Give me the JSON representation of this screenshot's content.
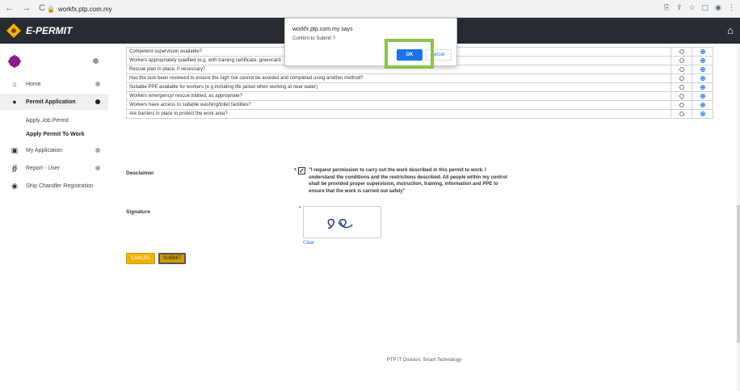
{
  "browser": {
    "url": "workfx.ptp.com.my",
    "nav_back": "←",
    "nav_forward": "→",
    "nav_reload": "C",
    "tools": [
      "⎘",
      "⇪",
      "☆",
      "▢",
      "◉",
      "⋮"
    ]
  },
  "topbar": {
    "brand": "E-PERMIT",
    "home_icon": "home-icon"
  },
  "sidebar": {
    "items": [
      {
        "label": "Home"
      },
      {
        "label": "Permit Application"
      },
      {
        "label": "Apply Job Permit"
      },
      {
        "label": "Apply Permit To Work"
      },
      {
        "label": "My Application"
      },
      {
        "label": "Report - User"
      },
      {
        "label": "Ship Chandler Registration"
      }
    ]
  },
  "questions": [
    {
      "text": "Competent supervision available?",
      "selected": "no"
    },
    {
      "text": "Workers appropriately qualified (e.g. with training certificate, greencard",
      "selected": "no"
    },
    {
      "text": "Rescue plan in place, if necessary?",
      "selected": "no"
    },
    {
      "text": "Has the task been reviewed to ensure the high risk cannot be avoided and completed using another method?",
      "selected": "no"
    },
    {
      "text": "Suitable PPE available for workers (e g including life jacket when working at near water)",
      "selected": "no"
    },
    {
      "text": "Workers emergency/ rescue trained, as appropriate?",
      "selected": "no"
    },
    {
      "text": "Workers have access to suitable washing/toilet facilities?",
      "selected": "no"
    },
    {
      "text": "Are barriers in place to protect the work area?",
      "selected": "no"
    }
  ],
  "disclaimer": {
    "label": "Desclaimer",
    "text": "\"I request permission to carry out the work described in this permit to work. I understand the conditions and the restrictions described. All people within my control shall be provided proper supervision, instruction, training, information and PPE to ensure that the work is carried out safely\"",
    "checked": true
  },
  "signature": {
    "label": "Signature",
    "clear": "Clear"
  },
  "buttons": {
    "cancel": "CANCEL",
    "submit": "SUBMIT"
  },
  "footer": "PTP IT Division, Smart Technology",
  "dialog": {
    "title": "workfx.ptp.com.my says",
    "message": "Confirm to Submit ?",
    "ok": "OK",
    "cancel": "ancel"
  },
  "colors": {
    "topbar": "#272c33",
    "accent_button": "#f0b400",
    "dialog_ok": "#1a73e8",
    "highlight": "#8bc34a"
  }
}
